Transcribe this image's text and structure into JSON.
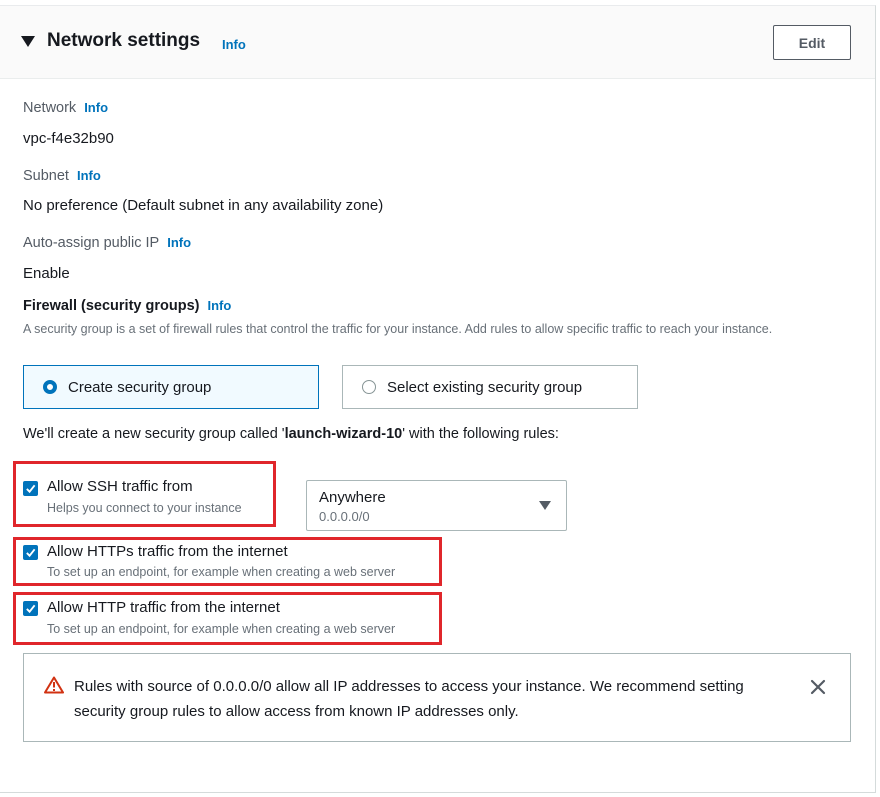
{
  "header": {
    "title": "Network settings",
    "info_label": "Info",
    "edit_label": "Edit"
  },
  "network": {
    "label": "Network",
    "info_label": "Info",
    "value": "vpc-f4e32b90"
  },
  "subnet": {
    "label": "Subnet",
    "info_label": "Info",
    "value": "No preference (Default subnet in any availability zone)"
  },
  "public_ip": {
    "label": "Auto-assign public IP",
    "info_label": "Info",
    "value": "Enable"
  },
  "firewall": {
    "title": "Firewall (security groups)",
    "info_label": "Info",
    "description": "A security group is a set of firewall rules that control the traffic for your instance. Add rules to allow specific traffic to reach your instance.",
    "options": [
      {
        "label": "Create security group",
        "selected": true
      },
      {
        "label": "Select existing security group",
        "selected": false
      }
    ],
    "new_group_prefix": "We'll create a new security group called '",
    "new_group_name": "launch-wizard-10",
    "new_group_suffix": "' with the following rules:"
  },
  "rules": [
    {
      "label": "Allow SSH traffic from",
      "description": "Helps you connect to your instance",
      "checked": true
    },
    {
      "label": "Allow HTTPs traffic from the internet",
      "description": "To set up an endpoint, for example when creating a web server",
      "checked": true
    },
    {
      "label": "Allow HTTP traffic from the internet",
      "description": "To set up an endpoint, for example when creating a web server",
      "checked": true
    }
  ],
  "ssh_source": {
    "selected": "Anywhere",
    "detail": "0.0.0.0/0"
  },
  "alert": {
    "message": "Rules with source of 0.0.0.0/0 allow all IP addresses to access your instance. We recommend setting security group rules to allow access from known IP addresses only."
  },
  "colors": {
    "accent": "#0073bb",
    "highlight": "#e0262b",
    "warning": "#d13212"
  }
}
